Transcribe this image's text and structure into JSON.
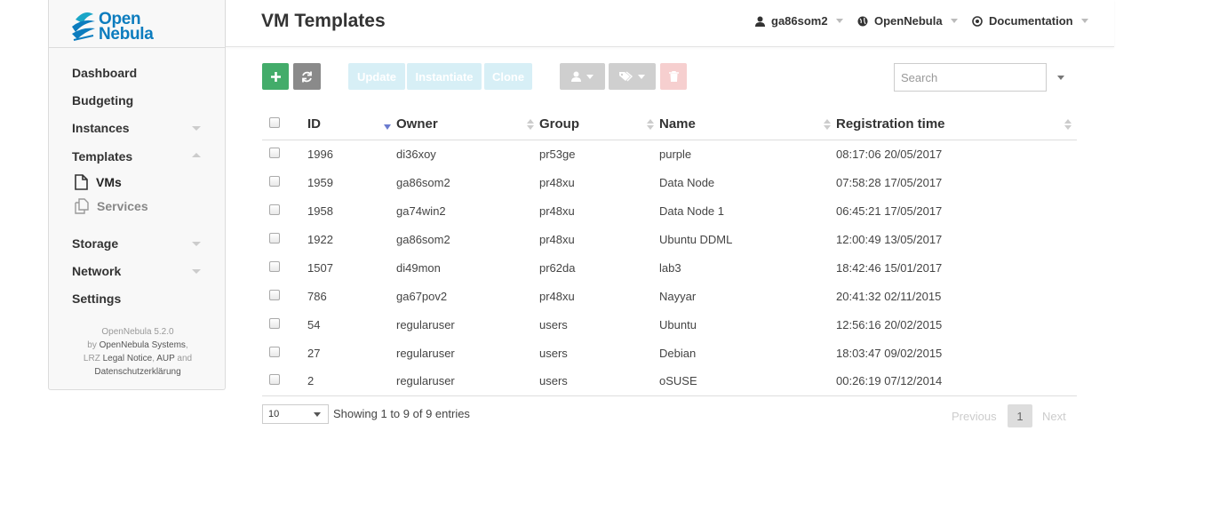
{
  "brand": {
    "line1": "Open",
    "line2": "Nebula"
  },
  "sidebar": {
    "items": [
      {
        "label": "Dashboard"
      },
      {
        "label": "Budgeting"
      },
      {
        "label": "Instances"
      },
      {
        "label": "Templates"
      },
      {
        "label": "Storage"
      },
      {
        "label": "Network"
      },
      {
        "label": "Settings"
      }
    ],
    "subitems": [
      {
        "label": "VMs",
        "icon": "file-icon"
      },
      {
        "label": "Services",
        "icon": "files-icon"
      }
    ],
    "footer": {
      "version": "OpenNebula 5.2.0",
      "by": "by",
      "systems": "OpenNebula Systems",
      "comma": ",",
      "lrz": "LRZ",
      "legal": "Legal Notice",
      "aup": "AUP",
      "and": "and",
      "privacy": "Datenschutzerklärung"
    }
  },
  "header": {
    "title": "VM Templates",
    "user": "ga86som2",
    "zone": "OpenNebula",
    "docs": "Documentation"
  },
  "toolbar": {
    "update": "Update",
    "instantiate": "Instantiate",
    "clone": "Clone",
    "search_placeholder": "Search"
  },
  "table": {
    "columns": [
      "ID",
      "Owner",
      "Group",
      "Name",
      "Registration time"
    ],
    "rows": [
      [
        "1996",
        "di36xoy",
        "pr53ge",
        "purple",
        "08:17:06 20/05/2017"
      ],
      [
        "1959",
        "ga86som2",
        "pr48xu",
        "Data Node",
        "07:58:28 17/05/2017"
      ],
      [
        "1958",
        "ga74win2",
        "pr48xu",
        "Data Node 1",
        "06:45:21 17/05/2017"
      ],
      [
        "1922",
        "ga86som2",
        "pr48xu",
        "Ubuntu DDML",
        "12:00:49 13/05/2017"
      ],
      [
        "1507",
        "di49mon",
        "pr62da",
        "lab3",
        "18:42:46 15/01/2017"
      ],
      [
        "786",
        "ga67pov2",
        "pr48xu",
        "Nayyar",
        "20:41:32 02/11/2015"
      ],
      [
        "54",
        "regularuser",
        "users",
        "Ubuntu",
        "12:56:16 20/02/2015"
      ],
      [
        "27",
        "regularuser",
        "users",
        "Debian",
        "18:03:47 09/02/2015"
      ],
      [
        "2",
        "regularuser",
        "users",
        "oSUSE",
        "00:26:19 07/12/2014"
      ]
    ]
  },
  "pagination": {
    "page_size": "10",
    "info": "Showing 1 to 9 of 9 entries",
    "previous": "Previous",
    "current": "1",
    "next": "Next"
  },
  "colors": {
    "create": "#43ac6a",
    "refresh": "#8a8a8a",
    "brand": "#0c7cbe",
    "delete_light": "#f6cfcf"
  }
}
